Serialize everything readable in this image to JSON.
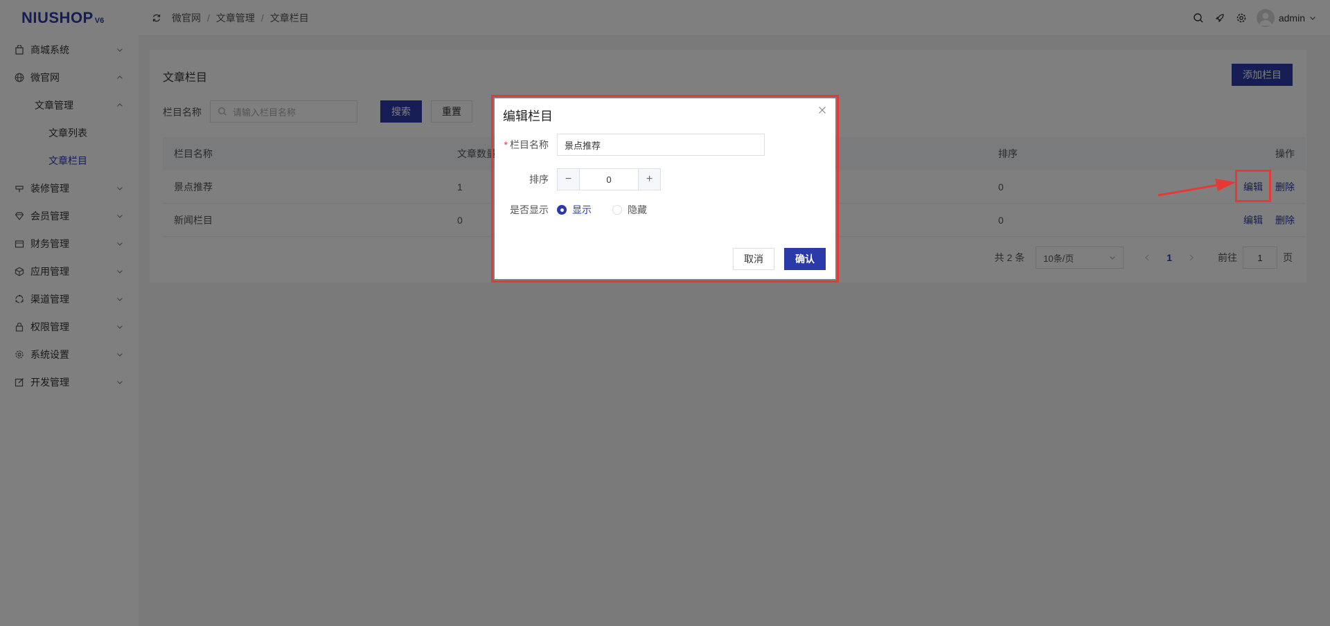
{
  "logo": {
    "text": "NIUSHOP",
    "version": "V6"
  },
  "sidebar": {
    "items": [
      {
        "label": "商城系统",
        "icon": "bag-icon",
        "expanded": false
      },
      {
        "label": "微官网",
        "icon": "globe-icon",
        "expanded": true
      },
      {
        "label": "文章管理",
        "level": 2,
        "expanded": true
      },
      {
        "label": "文章列表",
        "level": 3
      },
      {
        "label": "文章栏目",
        "level": 3,
        "active": true
      },
      {
        "label": "装修管理",
        "icon": "brush-icon",
        "expanded": false
      },
      {
        "label": "会员管理",
        "icon": "diamond-icon",
        "expanded": false
      },
      {
        "label": "财务管理",
        "icon": "wallet-icon",
        "expanded": false
      },
      {
        "label": "应用管理",
        "icon": "cube-icon",
        "expanded": false
      },
      {
        "label": "渠道管理",
        "icon": "channel-icon",
        "expanded": false
      },
      {
        "label": "权限管理",
        "icon": "lock-icon",
        "expanded": false
      },
      {
        "label": "系统设置",
        "icon": "gear-icon",
        "expanded": false
      },
      {
        "label": "开发管理",
        "icon": "edit-icon",
        "expanded": false
      }
    ]
  },
  "header": {
    "breadcrumb": [
      "微官网",
      "文章管理",
      "文章栏目"
    ],
    "separator": "/",
    "user": "admin"
  },
  "page": {
    "title": "文章栏目",
    "add_button": "添加栏目",
    "search": {
      "label": "栏目名称",
      "placeholder": "请输入栏目名称",
      "search_button": "搜索",
      "reset_button": "重置"
    }
  },
  "table": {
    "columns": [
      "栏目名称",
      "文章数量",
      "排序",
      "操作"
    ],
    "rows": [
      {
        "name": "景点推荐",
        "count": "1",
        "sort": "0",
        "edit": "编辑",
        "delete": "删除"
      },
      {
        "name": "新闻栏目",
        "count": "0",
        "sort": "0",
        "edit": "编辑",
        "delete": "删除"
      }
    ]
  },
  "pagination": {
    "total_text": "共 2 条",
    "page_size": "10条/页",
    "current_page": "1",
    "goto_label": "前往",
    "goto_value": "1",
    "page_unit": "页"
  },
  "dialog": {
    "title": "编辑栏目",
    "name_label": "栏目名称",
    "name_value": "景点推荐",
    "sort_label": "排序",
    "sort_value": "0",
    "show_label": "是否显示",
    "show_option": "显示",
    "hide_option": "隐藏",
    "selected": "显示",
    "cancel": "取消",
    "confirm": "确认"
  },
  "colors": {
    "primary": "#2a3aa8",
    "highlight": "#e53935"
  }
}
